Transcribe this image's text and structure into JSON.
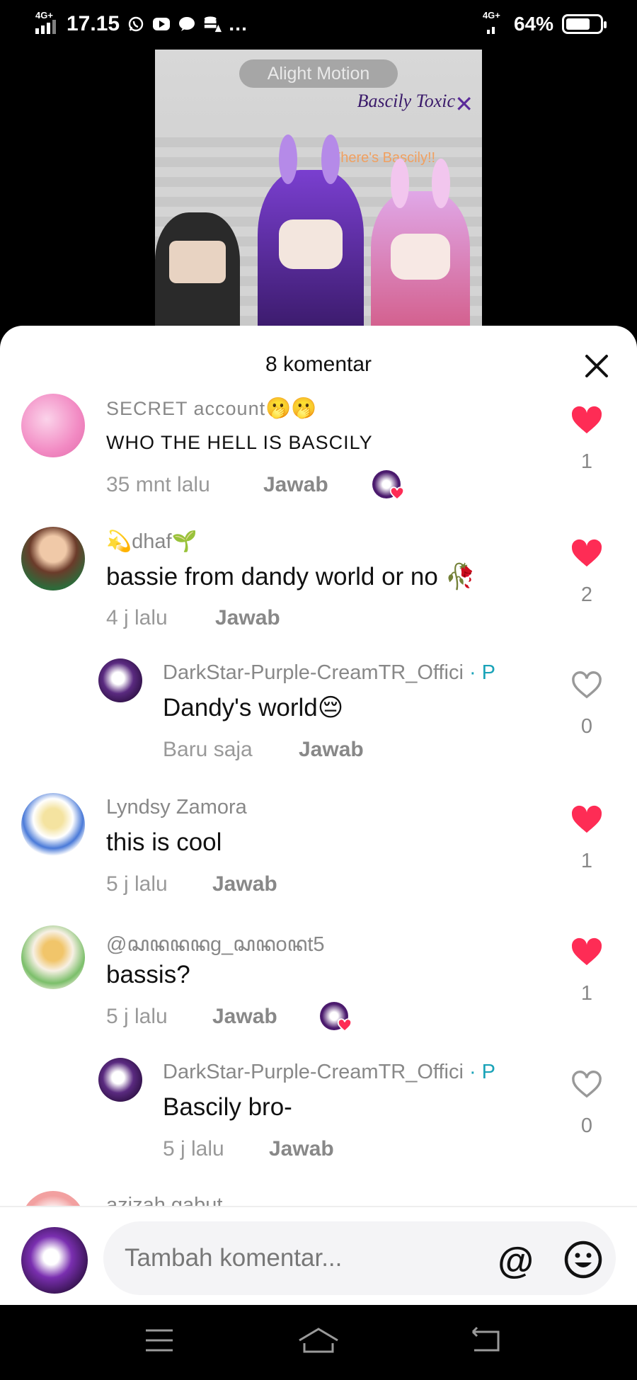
{
  "status_bar": {
    "time": "17.15",
    "network_left": "4G+",
    "network_right": "4G+",
    "more": "…",
    "battery_percent": "64%",
    "battery_level": 0.64,
    "icons": [
      "whatsapp-icon",
      "youtube-icon",
      "chat-bubble-icon",
      "stack-warning-icon"
    ]
  },
  "video": {
    "watermark": "Alight Motion",
    "title": "Bascily Toxic",
    "close_mark": "✕",
    "caption": "There's Bascily!!"
  },
  "sheet": {
    "title": "8 komentar",
    "close_icon": "close-icon"
  },
  "comments": [
    {
      "username": "SECRET account",
      "emoji": "🫢🫢",
      "text": "WHO THE HELL IS BASCILY",
      "time": "35 mnt lalu",
      "reply": "Jawab",
      "likes": "1",
      "liked": true,
      "creator_liked": true
    },
    {
      "username": "💫dhaf🌱",
      "text": "bassie from dandy world or no 🥀",
      "time": "4 j lalu",
      "reply": "Jawab",
      "likes": "2",
      "liked": true
    },
    {
      "username": "DarkStar-Purple-CreamTR_Offici",
      "tag": "· P",
      "text": "Dandy's world😔",
      "time": "Baru saja",
      "reply": "Jawab",
      "likes": "0",
      "liked": false,
      "is_reply": true
    },
    {
      "username": "Lyndsy Zamora",
      "text": "this is cool",
      "time": "5 j lalu",
      "reply": "Jawab",
      "likes": "1",
      "liked": true
    },
    {
      "username": "@ꦱꦤꦤꦤg_ꦱꦤoꦤt5",
      "text": "bassis?",
      "time": "5 j lalu",
      "reply": "Jawab",
      "likes": "1",
      "liked": true,
      "creator_liked": true
    },
    {
      "username": "DarkStar-Purple-CreamTR_Offici",
      "tag": "· P",
      "text": "Bascily bro-",
      "time": "5 j lalu",
      "reply": "Jawab",
      "likes": "0",
      "liked": false,
      "is_reply": true
    }
  ],
  "partial_comment": {
    "username": "azizah gabut"
  },
  "input": {
    "placeholder": "Tambah komentar...",
    "at_symbol": "@",
    "emoji_icon": "smiley-icon"
  },
  "nav": [
    "menu-icon",
    "home-icon",
    "back-icon"
  ]
}
